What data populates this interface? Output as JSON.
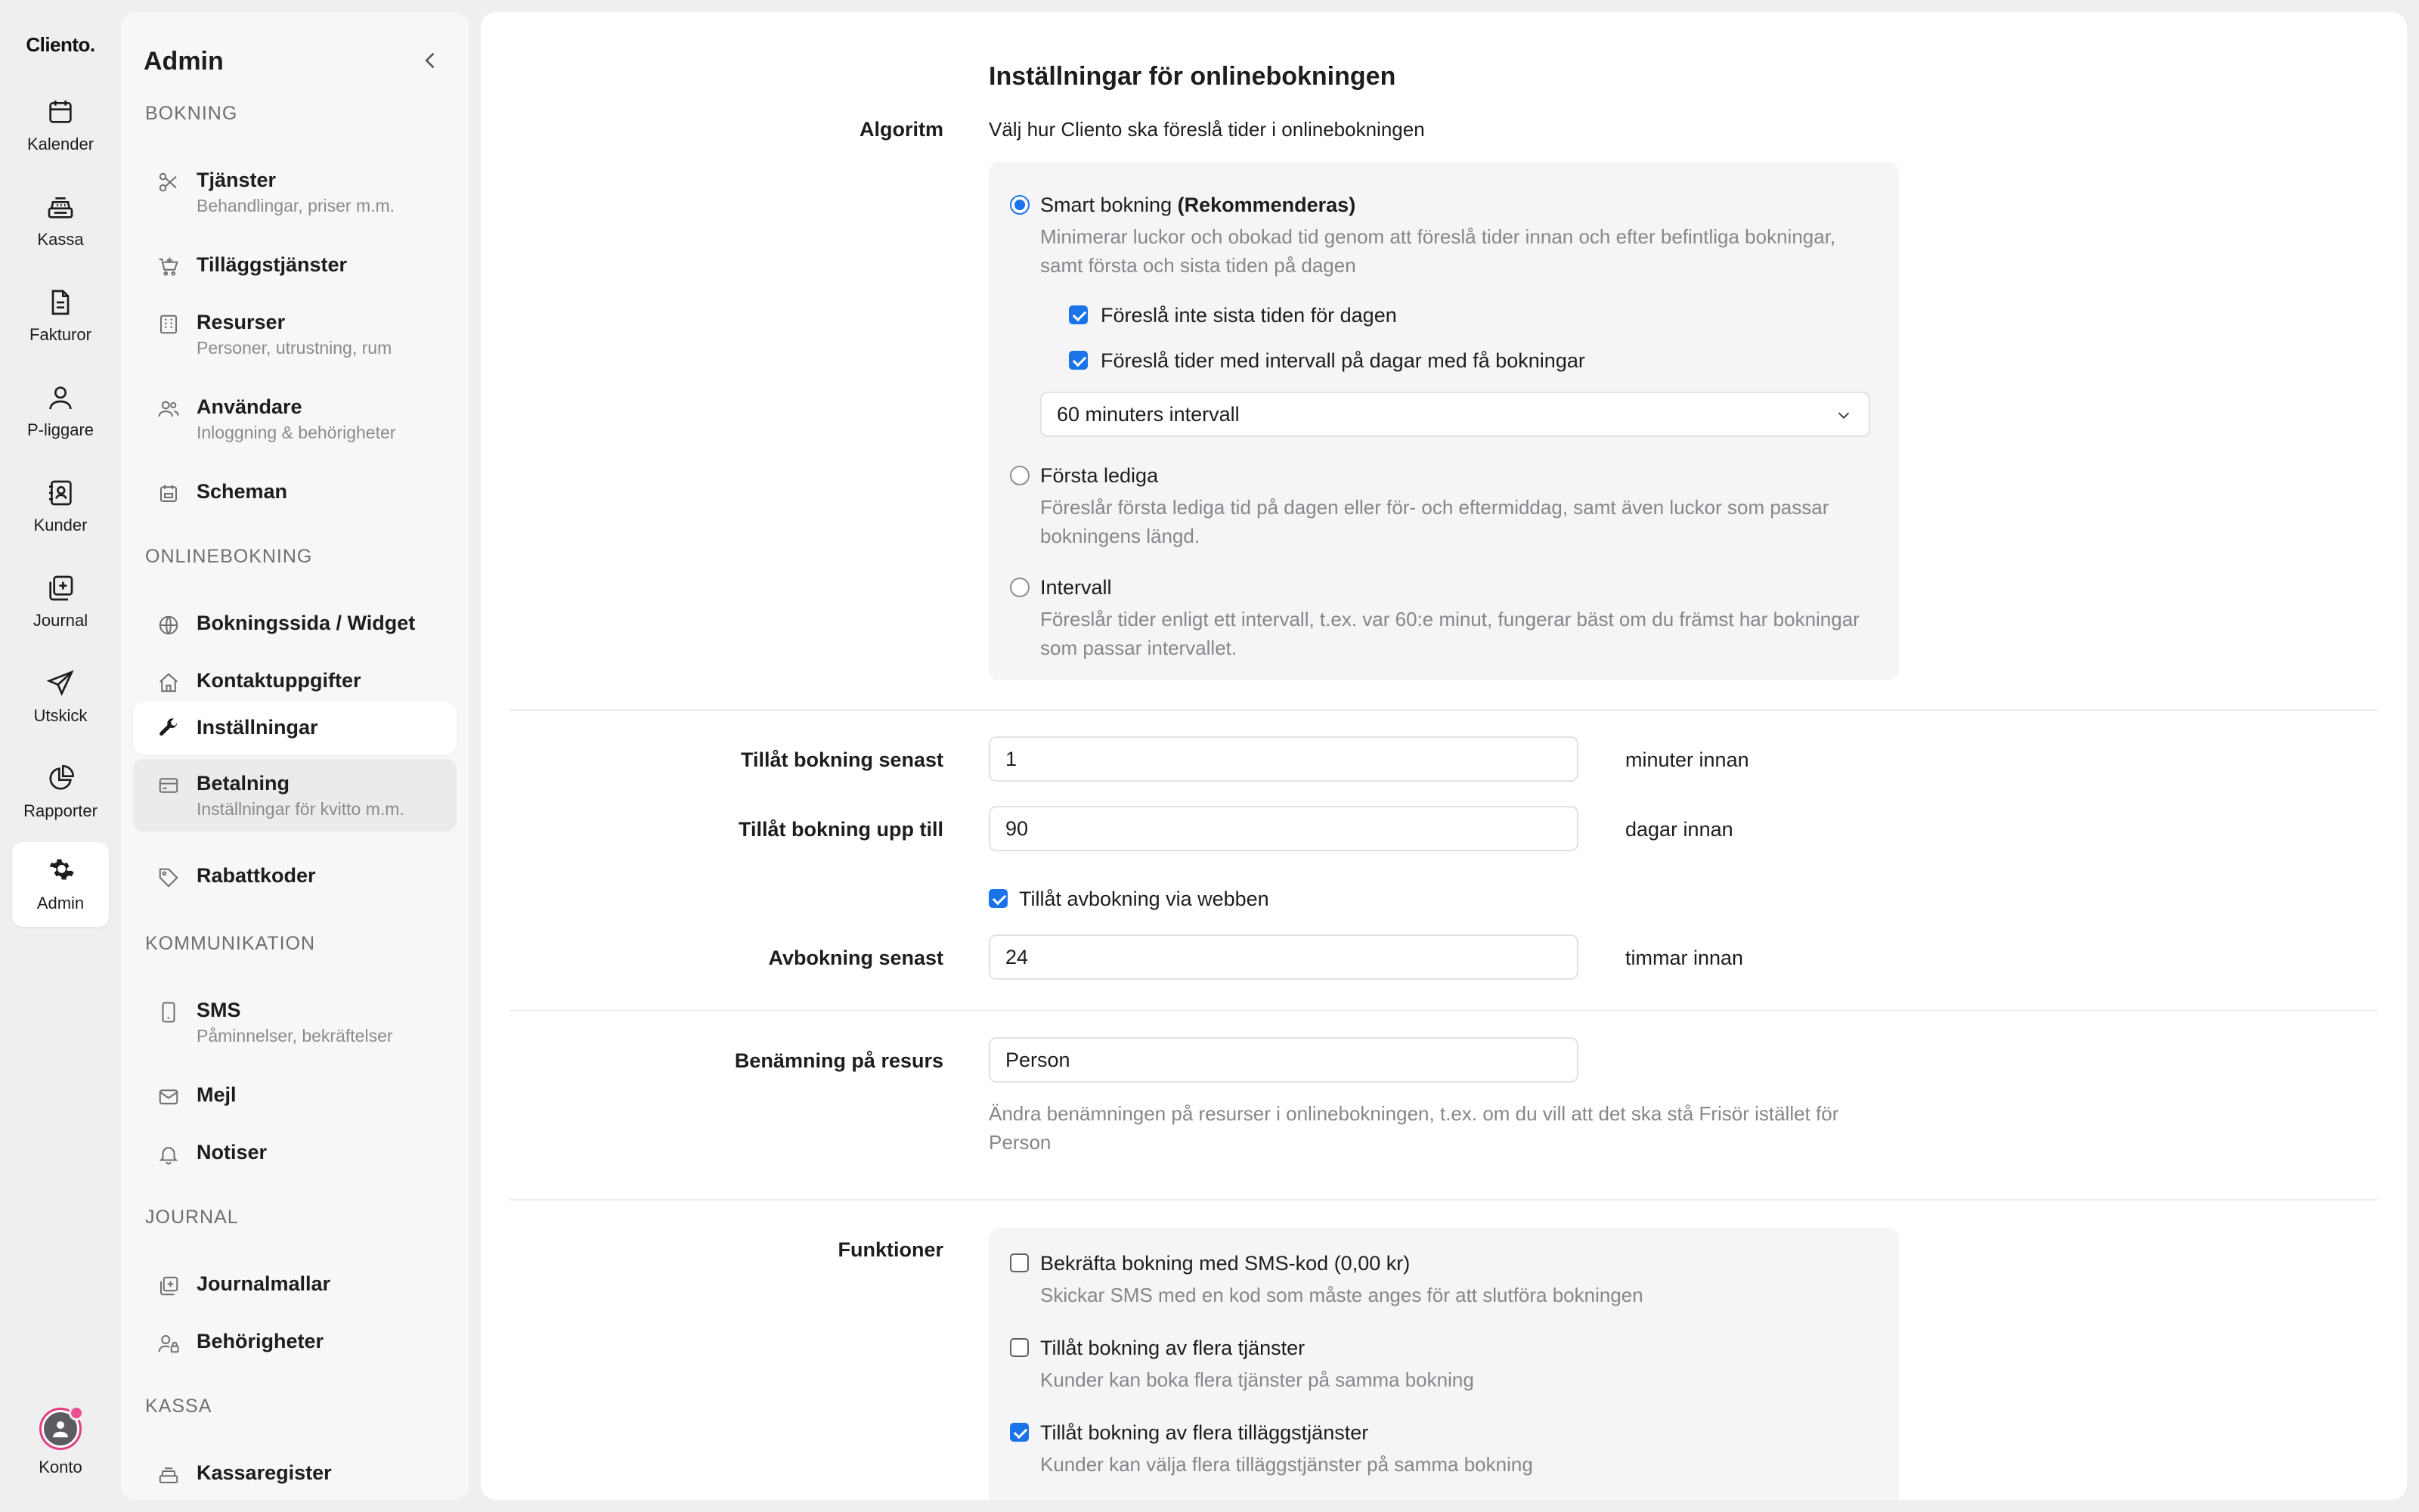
{
  "rail": {
    "logo": "Cliento.",
    "items": [
      {
        "label": "Kalender",
        "icon": "calendar-icon"
      },
      {
        "label": "Kassa",
        "icon": "cash-register-icon"
      },
      {
        "label": "Fakturor",
        "icon": "invoice-icon"
      },
      {
        "label": "P-liggare",
        "icon": "person-icon"
      },
      {
        "label": "Kunder",
        "icon": "contacts-icon"
      },
      {
        "label": "Journal",
        "icon": "journal-icon"
      },
      {
        "label": "Utskick",
        "icon": "send-icon"
      },
      {
        "label": "Rapporter",
        "icon": "pie-chart-icon"
      },
      {
        "label": "Admin",
        "icon": "gear-icon",
        "active": true
      }
    ],
    "account_label": "Konto"
  },
  "sidebar": {
    "title": "Admin",
    "sections": {
      "bokning": "BOKNING",
      "onlinebokning": "ONLINEBOKNING",
      "kommunikation": "KOMMUNIKATION",
      "journal": "JOURNAL",
      "kassa": "KASSA"
    },
    "items": {
      "tjanster": {
        "label": "Tjänster",
        "sub": "Behandlingar, priser m.m."
      },
      "tillaggstjanster": {
        "label": "Tilläggstjänster"
      },
      "resurser": {
        "label": "Resurser",
        "sub": "Personer, utrustning, rum"
      },
      "anvandare": {
        "label": "Användare",
        "sub": "Inloggning & behörigheter"
      },
      "scheman": {
        "label": "Scheman"
      },
      "bokningssida": {
        "label": "Bokningssida / Widget"
      },
      "kontaktuppgifter": {
        "label": "Kontaktuppgifter"
      },
      "installningar": {
        "label": "Inställningar"
      },
      "betalning": {
        "label": "Betalning",
        "sub": "Inställningar för kvitto m.m."
      },
      "rabattkoder": {
        "label": "Rabattkoder"
      },
      "sms": {
        "label": "SMS",
        "sub": "Påminnelser, bekräftelser"
      },
      "mejl": {
        "label": "Mejl"
      },
      "notiser": {
        "label": "Notiser"
      },
      "journalmallar": {
        "label": "Journalmallar"
      },
      "behorigheter": {
        "label": "Behörigheter"
      },
      "kassaregister": {
        "label": "Kassaregister"
      }
    }
  },
  "main": {
    "title": "Inställningar för onlinebokningen",
    "algorithm": {
      "label": "Algoritm",
      "description": "Välj hur Cliento ska föreslå tider i onlinebokningen",
      "smart": {
        "label": "Smart bokning",
        "badge": "(Rekommenderas)",
        "selected": true,
        "description": "Minimerar luckor och obokad tid genom att föreslå tider innan och efter befintliga bokningar, samt första och sista tiden på dagen",
        "opt_last": {
          "label": "Föreslå inte sista tiden för dagen",
          "checked": true
        },
        "opt_interval": {
          "label": "Föreslå tider med intervall på dagar med få bokningar",
          "checked": true
        },
        "interval_select": "60 minuters intervall"
      },
      "first": {
        "label": "Första lediga",
        "selected": false,
        "description": "Föreslår första lediga tid på dagen eller för- och eftermiddag, samt även luckor som passar bokningens längd."
      },
      "interval": {
        "label": "Intervall",
        "selected": false,
        "description": "Föreslår tider enligt ett intervall, t.ex. var 60:e minut, fungerar bäst om du främst har bokningar som passar intervallet."
      }
    },
    "booking_latest": {
      "label": "Tillåt bokning senast",
      "value": "1",
      "unit": "minuter innan"
    },
    "booking_until": {
      "label": "Tillåt bokning upp till",
      "value": "90",
      "unit": "dagar innan"
    },
    "allow_cancel": {
      "label": "Tillåt avbokning via webben",
      "checked": true
    },
    "cancel_latest": {
      "label": "Avbokning senast",
      "value": "24",
      "unit": "timmar innan"
    },
    "resource_name": {
      "label": "Benämning på resurs",
      "value": "Person",
      "help": "Ändra benämningen på resurser i onlinebokningen, t.ex. om du vill att det ska stå Frisör istället för Person"
    },
    "functions": {
      "label": "Funktioner",
      "sms_code": {
        "label": "Bekräfta bokning med SMS-kod (0,00 kr)",
        "description": "Skickar SMS med en kod som måste anges för att slutföra bokningen",
        "checked": false
      },
      "multi_services": {
        "label": "Tillåt bokning av flera tjänster",
        "description": "Kunder kan boka flera tjänster på samma bokning",
        "checked": false
      },
      "multi_addons": {
        "label": "Tillåt bokning av flera tilläggstjänster",
        "description": "Kunder kan välja flera tilläggstjänster på samma bokning",
        "checked": true
      }
    }
  },
  "colors": {
    "accent": "#1a73e8",
    "badge": "#ec4f91"
  }
}
